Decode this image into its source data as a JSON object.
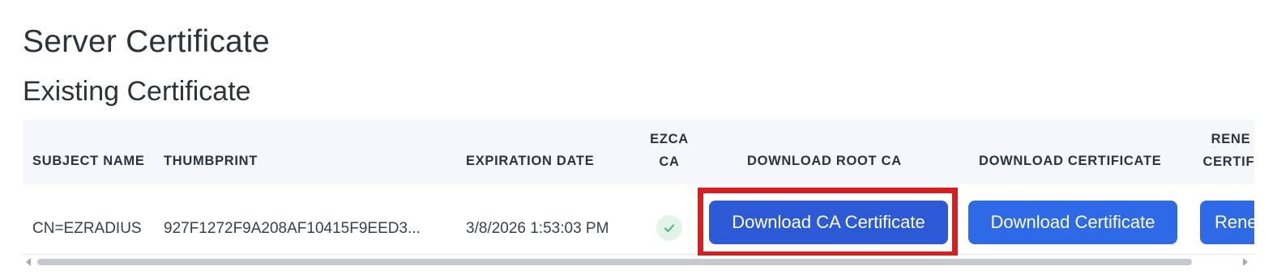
{
  "page": {
    "title": "Server Certificate",
    "subtitle": "Existing Certificate"
  },
  "table": {
    "headers": {
      "subject_name": "SUBJECT NAME",
      "thumbprint": "THUMBPRINT",
      "expiration_date": "EXPIRATION DATE",
      "ezca_ca_line1": "EZCA",
      "ezca_ca_line2": "CA",
      "download_root_ca": "DOWNLOAD ROOT CA",
      "download_certificate": "DOWNLOAD CERTIFICATE",
      "renew_line1": "RENE",
      "renew_line2": "CERTIFI"
    },
    "rows": [
      {
        "subject_name": "CN=EZRADIUS",
        "thumbprint": "927F1272F9A208AF10415F9EED3...",
        "expiration_date": "3/8/2026 1:53:03 PM",
        "ezca_ca_icon": "check-icon",
        "download_ca_label": "Download CA Certificate",
        "download_certificate_label": "Download Certificate",
        "renew_label": "Rene"
      }
    ]
  },
  "colors": {
    "primary_button": "#2f6ae6",
    "primary_button_active": "#2c5ad6",
    "highlight": "#e01b1b",
    "check_bg": "#e2f4ea",
    "check": "#4caf7d"
  }
}
